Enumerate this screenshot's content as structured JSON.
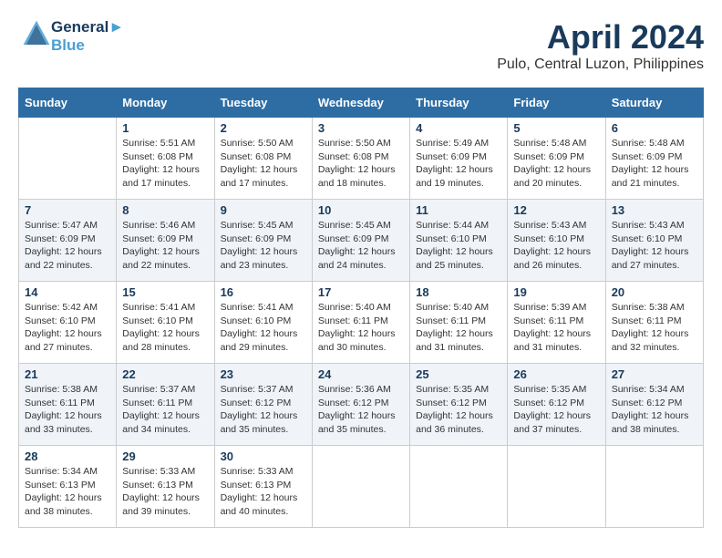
{
  "header": {
    "logo_line1": "General",
    "logo_line2": "Blue",
    "title": "April 2024",
    "subtitle": "Pulo, Central Luzon, Philippines"
  },
  "calendar": {
    "days_of_week": [
      "Sunday",
      "Monday",
      "Tuesday",
      "Wednesday",
      "Thursday",
      "Friday",
      "Saturday"
    ],
    "weeks": [
      [
        {
          "day": "",
          "info": ""
        },
        {
          "day": "1",
          "info": "Sunrise: 5:51 AM\nSunset: 6:08 PM\nDaylight: 12 hours\nand 17 minutes."
        },
        {
          "day": "2",
          "info": "Sunrise: 5:50 AM\nSunset: 6:08 PM\nDaylight: 12 hours\nand 17 minutes."
        },
        {
          "day": "3",
          "info": "Sunrise: 5:50 AM\nSunset: 6:08 PM\nDaylight: 12 hours\nand 18 minutes."
        },
        {
          "day": "4",
          "info": "Sunrise: 5:49 AM\nSunset: 6:09 PM\nDaylight: 12 hours\nand 19 minutes."
        },
        {
          "day": "5",
          "info": "Sunrise: 5:48 AM\nSunset: 6:09 PM\nDaylight: 12 hours\nand 20 minutes."
        },
        {
          "day": "6",
          "info": "Sunrise: 5:48 AM\nSunset: 6:09 PM\nDaylight: 12 hours\nand 21 minutes."
        }
      ],
      [
        {
          "day": "7",
          "info": "Sunrise: 5:47 AM\nSunset: 6:09 PM\nDaylight: 12 hours\nand 22 minutes."
        },
        {
          "day": "8",
          "info": "Sunrise: 5:46 AM\nSunset: 6:09 PM\nDaylight: 12 hours\nand 22 minutes."
        },
        {
          "day": "9",
          "info": "Sunrise: 5:45 AM\nSunset: 6:09 PM\nDaylight: 12 hours\nand 23 minutes."
        },
        {
          "day": "10",
          "info": "Sunrise: 5:45 AM\nSunset: 6:09 PM\nDaylight: 12 hours\nand 24 minutes."
        },
        {
          "day": "11",
          "info": "Sunrise: 5:44 AM\nSunset: 6:10 PM\nDaylight: 12 hours\nand 25 minutes."
        },
        {
          "day": "12",
          "info": "Sunrise: 5:43 AM\nSunset: 6:10 PM\nDaylight: 12 hours\nand 26 minutes."
        },
        {
          "day": "13",
          "info": "Sunrise: 5:43 AM\nSunset: 6:10 PM\nDaylight: 12 hours\nand 27 minutes."
        }
      ],
      [
        {
          "day": "14",
          "info": "Sunrise: 5:42 AM\nSunset: 6:10 PM\nDaylight: 12 hours\nand 27 minutes."
        },
        {
          "day": "15",
          "info": "Sunrise: 5:41 AM\nSunset: 6:10 PM\nDaylight: 12 hours\nand 28 minutes."
        },
        {
          "day": "16",
          "info": "Sunrise: 5:41 AM\nSunset: 6:10 PM\nDaylight: 12 hours\nand 29 minutes."
        },
        {
          "day": "17",
          "info": "Sunrise: 5:40 AM\nSunset: 6:11 PM\nDaylight: 12 hours\nand 30 minutes."
        },
        {
          "day": "18",
          "info": "Sunrise: 5:40 AM\nSunset: 6:11 PM\nDaylight: 12 hours\nand 31 minutes."
        },
        {
          "day": "19",
          "info": "Sunrise: 5:39 AM\nSunset: 6:11 PM\nDaylight: 12 hours\nand 31 minutes."
        },
        {
          "day": "20",
          "info": "Sunrise: 5:38 AM\nSunset: 6:11 PM\nDaylight: 12 hours\nand 32 minutes."
        }
      ],
      [
        {
          "day": "21",
          "info": "Sunrise: 5:38 AM\nSunset: 6:11 PM\nDaylight: 12 hours\nand 33 minutes."
        },
        {
          "day": "22",
          "info": "Sunrise: 5:37 AM\nSunset: 6:11 PM\nDaylight: 12 hours\nand 34 minutes."
        },
        {
          "day": "23",
          "info": "Sunrise: 5:37 AM\nSunset: 6:12 PM\nDaylight: 12 hours\nand 35 minutes."
        },
        {
          "day": "24",
          "info": "Sunrise: 5:36 AM\nSunset: 6:12 PM\nDaylight: 12 hours\nand 35 minutes."
        },
        {
          "day": "25",
          "info": "Sunrise: 5:35 AM\nSunset: 6:12 PM\nDaylight: 12 hours\nand 36 minutes."
        },
        {
          "day": "26",
          "info": "Sunrise: 5:35 AM\nSunset: 6:12 PM\nDaylight: 12 hours\nand 37 minutes."
        },
        {
          "day": "27",
          "info": "Sunrise: 5:34 AM\nSunset: 6:12 PM\nDaylight: 12 hours\nand 38 minutes."
        }
      ],
      [
        {
          "day": "28",
          "info": "Sunrise: 5:34 AM\nSunset: 6:13 PM\nDaylight: 12 hours\nand 38 minutes."
        },
        {
          "day": "29",
          "info": "Sunrise: 5:33 AM\nSunset: 6:13 PM\nDaylight: 12 hours\nand 39 minutes."
        },
        {
          "day": "30",
          "info": "Sunrise: 5:33 AM\nSunset: 6:13 PM\nDaylight: 12 hours\nand 40 minutes."
        },
        {
          "day": "",
          "info": ""
        },
        {
          "day": "",
          "info": ""
        },
        {
          "day": "",
          "info": ""
        },
        {
          "day": "",
          "info": ""
        }
      ]
    ]
  }
}
